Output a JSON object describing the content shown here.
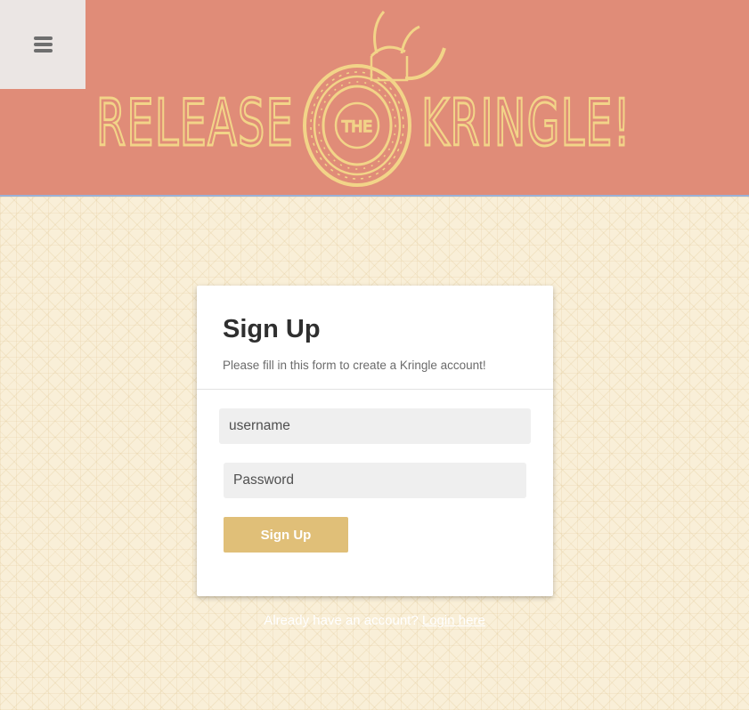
{
  "header": {
    "menu_icon": "hamburger-menu-icon",
    "logo": {
      "words_left": "RELEASE",
      "word_middle": "THE",
      "words_right": "KRINGLE!",
      "emblem_icon": "viking-kringle-emblem-icon"
    }
  },
  "form": {
    "title": "Sign Up",
    "subtitle": "Please fill in this form to create a Kringle account!",
    "username_placeholder": "username",
    "password_placeholder": "Password",
    "submit_label": "Sign Up"
  },
  "footer": {
    "prompt": "Already have an account? ",
    "link_label": "Login here"
  },
  "colors": {
    "header_bg": "#e08c78",
    "logo_gold": "#f2d488",
    "button_bg": "#e0bf78",
    "page_bg": "#f9efd8"
  }
}
